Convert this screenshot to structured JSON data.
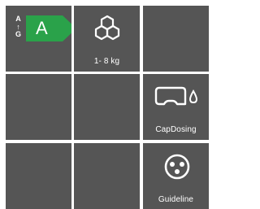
{
  "tiles": {
    "energy": {
      "scale_top": "A",
      "scale_bottom": "G",
      "rating": "A",
      "rating_color": "#2aa24a"
    },
    "capacity": {
      "icon": "laundry-load-icon",
      "label": "1- 8 kg"
    },
    "capdosing": {
      "icon": "capsule-drop-icon",
      "label": "CapDosing"
    },
    "guideline": {
      "icon": "guideline-dots-icon",
      "label": "Guideline"
    }
  },
  "colors": {
    "tile_background": "#555555",
    "page_background": "#ffffff",
    "foreground": "#ffffff"
  }
}
